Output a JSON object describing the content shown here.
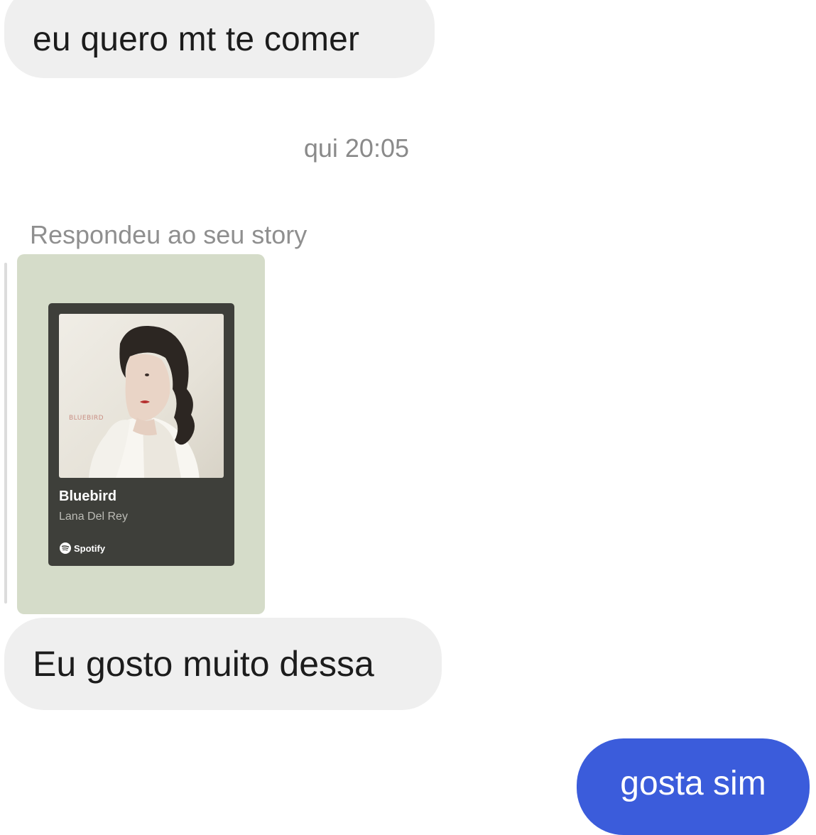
{
  "messages": {
    "incoming_1": "eu quero mt te comer",
    "timestamp": "qui 20:05",
    "story_reply_caption": "Respondeu ao seu story",
    "incoming_2": "Eu gosto muito dessa",
    "outgoing_1": "gosta sim"
  },
  "story": {
    "background_color": "#d5dcc9",
    "spotify_card": {
      "cover_text": "BLUEBIRD",
      "title": "Bluebird",
      "artist": "Lana Del Rey",
      "brand": "Spotify",
      "brand_icon": "spotify-icon"
    }
  },
  "colors": {
    "incoming_bubble": "#efefef",
    "outgoing_bubble": "#3b5cdb",
    "meta_text": "#8a8a8a"
  }
}
